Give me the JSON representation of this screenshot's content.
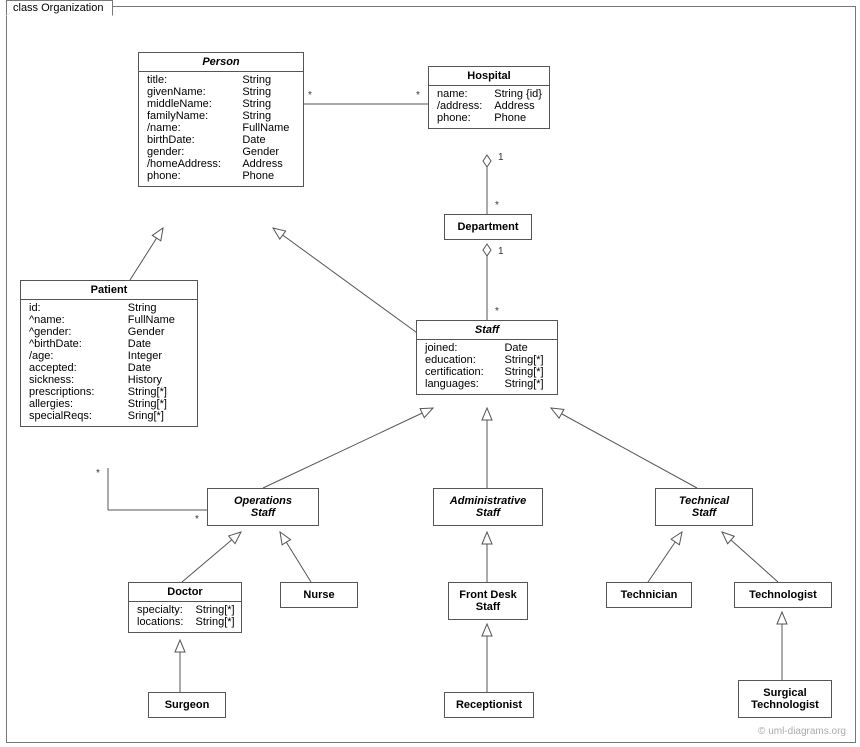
{
  "frame": {
    "label": "class Organization"
  },
  "watermark": "© uml-diagrams.org",
  "classes": {
    "person": {
      "title": "Person",
      "attrs": [
        [
          "title:",
          "String"
        ],
        [
          "givenName:",
          "String"
        ],
        [
          "middleName:",
          "String"
        ],
        [
          "familyName:",
          "String"
        ],
        [
          "/name:",
          "FullName"
        ],
        [
          "birthDate:",
          "Date"
        ],
        [
          "gender:",
          "Gender"
        ],
        [
          "/homeAddress:",
          "Address"
        ],
        [
          "phone:",
          "Phone"
        ]
      ]
    },
    "hospital": {
      "title": "Hospital",
      "attrs": [
        [
          "name:",
          "String {id}"
        ],
        [
          "/address:",
          "Address"
        ],
        [
          "phone:",
          "Phone"
        ]
      ]
    },
    "department": {
      "title": "Department"
    },
    "patient": {
      "title": "Patient",
      "attrs": [
        [
          "id:",
          "String"
        ],
        [
          "^name:",
          "FullName"
        ],
        [
          "^gender:",
          "Gender"
        ],
        [
          "^birthDate:",
          "Date"
        ],
        [
          "/age:",
          "Integer"
        ],
        [
          "accepted:",
          "Date"
        ],
        [
          "sickness:",
          "History"
        ],
        [
          "prescriptions:",
          "String[*]"
        ],
        [
          "allergies:",
          "String[*]"
        ],
        [
          "specialReqs:",
          "Sring[*]"
        ]
      ]
    },
    "staff": {
      "title": "Staff",
      "attrs": [
        [
          "joined:",
          "Date"
        ],
        [
          "education:",
          "String[*]"
        ],
        [
          "certification:",
          "String[*]"
        ],
        [
          "languages:",
          "String[*]"
        ]
      ]
    },
    "opsStaff": {
      "title": "Operations\nStaff"
    },
    "adminStaff": {
      "title": "Administrative\nStaff"
    },
    "techStaff": {
      "title": "Technical\nStaff"
    },
    "doctor": {
      "title": "Doctor",
      "attrs": [
        [
          "specialty:",
          "String[*]"
        ],
        [
          "locations:",
          "String[*]"
        ]
      ]
    },
    "nurse": {
      "title": "Nurse"
    },
    "frontDesk": {
      "title": "Front Desk\nStaff"
    },
    "receptionist": {
      "title": "Receptionist"
    },
    "technician": {
      "title": "Technician"
    },
    "technologist": {
      "title": "Technologist"
    },
    "surgeon": {
      "title": "Surgeon"
    },
    "surgTech": {
      "title": "Surgical\nTechnologist"
    }
  },
  "mults": {
    "personHospL": "*",
    "personHospR": "*",
    "hospDept1": "1",
    "hospDeptStar": "*",
    "deptStaff1": "1",
    "deptStaffStar": "*",
    "patientOpsStarL": "*",
    "patientOpsStarR": "*"
  }
}
